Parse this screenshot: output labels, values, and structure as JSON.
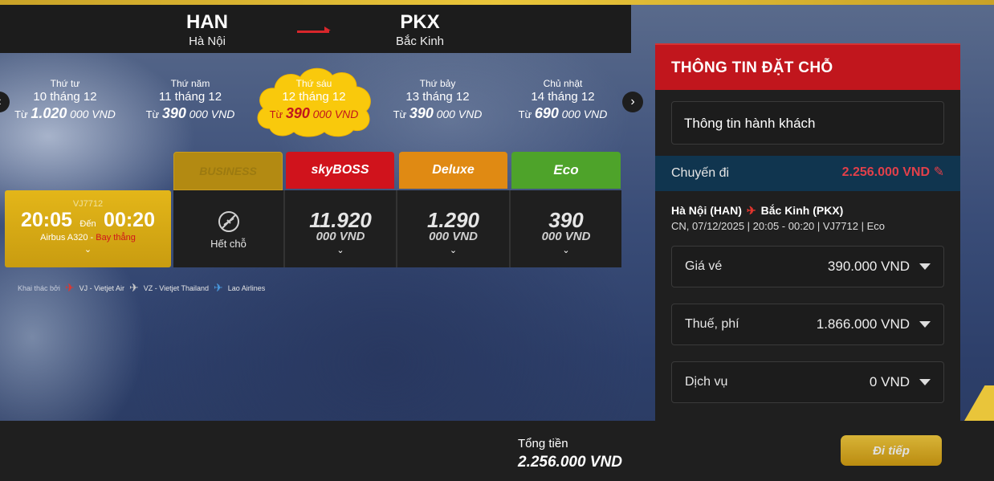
{
  "route": {
    "from_code": "HAN",
    "from_city": "Hà Nội",
    "to_code": "PKX",
    "to_city": "Bắc Kinh"
  },
  "dates": [
    {
      "dow": "Thứ tư",
      "date": "10 tháng 12",
      "prefix": "Từ",
      "amount": "1.020",
      "unit": "000 VND",
      "selected": false
    },
    {
      "dow": "Thứ năm",
      "date": "11 tháng 12",
      "prefix": "Từ",
      "amount": "390",
      "unit": "000 VND",
      "selected": false
    },
    {
      "dow": "Thứ sáu",
      "date": "12 tháng 12",
      "prefix": "Từ",
      "amount": "390",
      "unit": "000 VND",
      "selected": true
    },
    {
      "dow": "Thứ bảy",
      "date": "13 tháng 12",
      "prefix": "Từ",
      "amount": "390",
      "unit": "000 VND",
      "selected": false
    },
    {
      "dow": "Chủ nhật",
      "date": "14 tháng 12",
      "prefix": "Từ",
      "amount": "690",
      "unit": "000 VND",
      "selected": false
    }
  ],
  "nav": {
    "prev": "‹",
    "next": "›"
  },
  "fare_classes": [
    {
      "name": "BUSINESS",
      "color": "#b38a12",
      "text_color": "#9c7a10"
    },
    {
      "name": "skyBOSS",
      "color": "#d0131c",
      "text_color": "#ffffff"
    },
    {
      "name": "Deluxe",
      "color": "#e08a13",
      "text_color": "#ffffff"
    },
    {
      "name": "Eco",
      "color": "#4ea32a",
      "text_color": "#ffffff"
    }
  ],
  "flight": {
    "number": "VJ7712",
    "depart": "20:05",
    "arrive_label": "Đến",
    "arrive": "00:20",
    "aircraft": "Airbus A320 -",
    "type": "Bay thẳng",
    "chevron": "⌄"
  },
  "fares": [
    {
      "soldout": true,
      "label": "Hết chỗ"
    },
    {
      "amount": "11.920",
      "unit": "000 VND",
      "chevron": "⌄"
    },
    {
      "amount": "1.290",
      "unit": "000 VND",
      "chevron": "⌄"
    },
    {
      "amount": "390",
      "unit": "000 VND",
      "chevron": "⌄"
    }
  ],
  "operators": {
    "label": "Khai thác bởi",
    "items": [
      {
        "name": "VJ - Vietjet Air",
        "color": "#e3352d"
      },
      {
        "name": "VZ - Vietjet Thailand",
        "color": "#cccccc"
      },
      {
        "name": "Lao Airlines",
        "color": "#4a9be0"
      }
    ]
  },
  "booking": {
    "title": "THÔNG TIN ĐẶT CHỖ",
    "passenger": "Thông tin hành khách",
    "trip_label": "Chuyến đi",
    "trip_total": "2.256.000 VND",
    "route_from": "Hà Nội (HAN)",
    "route_to": "Bắc Kinh (PKX)",
    "detail": "CN, 07/12/2025 | 20:05 - 00:20 | VJ7712 | Eco",
    "rows": [
      {
        "label": "Giá vé",
        "value": "390.000 VND"
      },
      {
        "label": "Thuế, phí",
        "value": "1.866.000 VND"
      },
      {
        "label": "Dịch vụ",
        "value": "0 VND"
      }
    ]
  },
  "footer": {
    "total_label": "Tổng tiền",
    "total_value": "2.256.000 VND",
    "next_button": "Đi tiếp"
  }
}
